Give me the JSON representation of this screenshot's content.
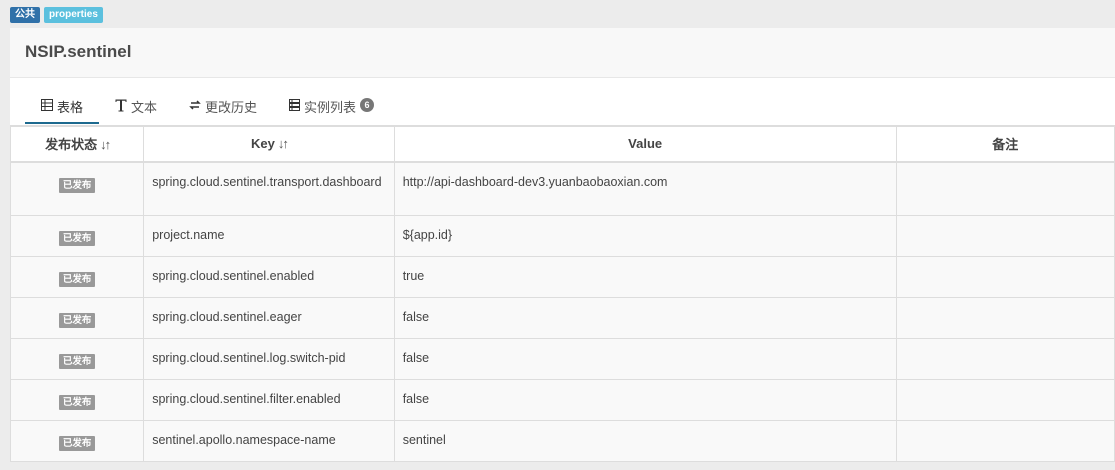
{
  "badges": {
    "scope": "公共",
    "format": "properties"
  },
  "namespace_title": "NSIP.sentinel",
  "tabs": [
    {
      "label": "表格",
      "icon": "table-icon"
    },
    {
      "label": "文本",
      "icon": "text-icon"
    },
    {
      "label": "更改历史",
      "icon": "history-icon"
    },
    {
      "label": "实例列表",
      "icon": "server-list-icon",
      "count": "6"
    }
  ],
  "table": {
    "headers": {
      "status": "发布状态",
      "key": "Key",
      "value": "Value",
      "comment": "备注"
    },
    "rows": [
      {
        "status": "已发布",
        "key": "spring.cloud.sentinel.transport.dashboard",
        "value": "http://api-dashboard-dev3.yuanbaobaoxian.com",
        "comment": ""
      },
      {
        "status": "已发布",
        "key": "project.name",
        "value": "${app.id}",
        "comment": ""
      },
      {
        "status": "已发布",
        "key": "spring.cloud.sentinel.enabled",
        "value": "true",
        "comment": ""
      },
      {
        "status": "已发布",
        "key": "spring.cloud.sentinel.eager",
        "value": "false",
        "comment": ""
      },
      {
        "status": "已发布",
        "key": "spring.cloud.sentinel.log.switch-pid",
        "value": "false",
        "comment": ""
      },
      {
        "status": "已发布",
        "key": "spring.cloud.sentinel.filter.enabled",
        "value": "false",
        "comment": ""
      },
      {
        "status": "已发布",
        "key": "sentinel.apollo.namespace-name",
        "value": "sentinel",
        "comment": ""
      }
    ]
  }
}
